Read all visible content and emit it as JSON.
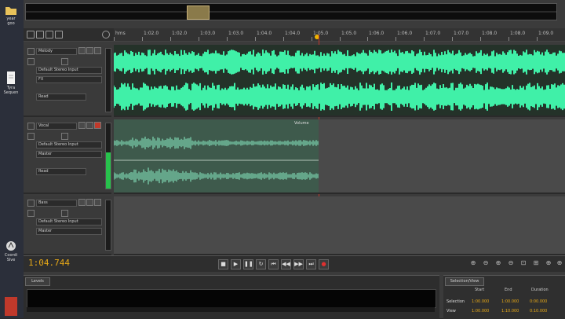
{
  "desktop": {
    "items": [
      {
        "label": "year\ngoo",
        "icon": "folder-icon"
      },
      {
        "label": "Tyra\nSequen",
        "icon": "document-icon"
      },
      {
        "label": "Coordi\nSlve",
        "icon": "shortcut-icon"
      }
    ]
  },
  "ruler": {
    "labels": [
      "hms",
      "1:02.0",
      "1:02.0",
      "1:03.0",
      "1:03.0",
      "1:04.0",
      "1:04.0",
      "1:05.0",
      "1:05.0",
      "1:06.0",
      "1:06.0",
      "1:07.0",
      "1:07.0",
      "1:08.0",
      "1:08.0",
      "1:09.0"
    ]
  },
  "tracks": [
    {
      "name": "Melody",
      "input": "Default Stereo Input",
      "output": "FX",
      "mode": "Read",
      "meter_level": 0.0,
      "clip_label": ""
    },
    {
      "name": "Vocal",
      "input": "Default Stereo Input",
      "output": "Master",
      "mode": "Read",
      "meter_level": 0.55,
      "clip_label": "Volume"
    },
    {
      "name": "Bass",
      "input": "Default Stereo Input",
      "output": "Master",
      "mode": "Read",
      "meter_level": 0.0,
      "clip_label": ""
    }
  ],
  "transport": {
    "timecode": "1:04.744"
  },
  "levels": {
    "tab": "Levels"
  },
  "selection": {
    "tab": "Selection/View",
    "headers": [
      "Start",
      "End",
      "Duration"
    ],
    "rows": [
      {
        "label": "Selection",
        "values": [
          "1:00.000",
          "1:00.000",
          "0:00.000"
        ]
      },
      {
        "label": "View",
        "values": [
          "1:00.000",
          "1:10.000",
          "0:10.000"
        ]
      }
    ]
  },
  "colors": {
    "waveform_bright": "#40f0a8",
    "waveform_dim": "#6fb99a",
    "clip_bg_dim": "#3e5a4c",
    "timecode": "#e6a817",
    "playhead": "#c0392b"
  }
}
